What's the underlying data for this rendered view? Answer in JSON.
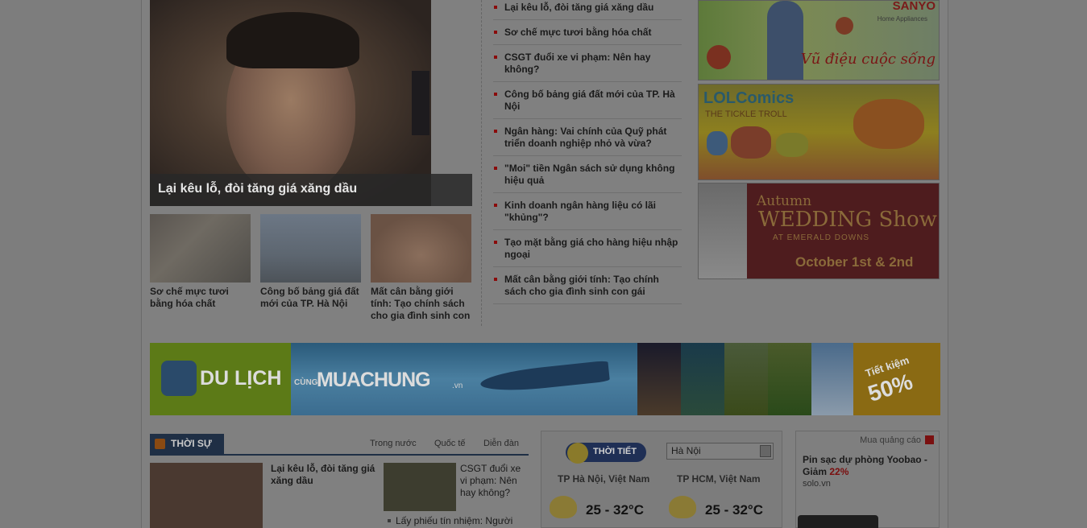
{
  "featured": {
    "caption": "Lại kêu lỗ, đòi tăng giá xăng dầu"
  },
  "thumbs": [
    {
      "caption": "Sơ chế mực tươi bằng hóa chất"
    },
    {
      "caption": "Công bố bảng giá đất mới của TP. Hà Nội"
    },
    {
      "caption": "Mất cân bằng giới tính: Tạo chính sách cho gia đình sinh con"
    }
  ],
  "news": [
    "Lại kêu lỗ, đòi tăng giá xăng dầu",
    "Sơ chế mực tươi bằng hóa chất",
    "CSGT đuổi xe vi phạm: Nên hay không?",
    "Công bố bảng giá đất mới của TP. Hà Nội",
    "Ngân hàng: Vai chính của Quỹ phát triển doanh nghiệp nhỏ và vừa?",
    "\"Moi\" tiền Ngân sách sử dụng không hiệu quả",
    "Kinh doanh ngân hàng liệu có lãi \"khủng\"?",
    "Tạo mặt bằng giá cho hàng hiệu nhập ngoại",
    "Mất cân bằng giới tính: Tạo chính sách cho gia đình sinh con gái"
  ],
  "ads": {
    "sanyo_brand": "SANYO",
    "sanyo_sub": "Home Appliances",
    "sanyo_slogan": "Vũ điệu cuộc sống",
    "lol_title": "LOLComics",
    "lol_sub": "THE TICKLE TROLL",
    "wedding_line1": "Autumn",
    "wedding_line2": "WEDDING Show",
    "wedding_line3": "AT EMERALD DOWNS",
    "wedding_date": "October 1st & 2nd"
  },
  "banner": {
    "brand_left": "DU LỊCH",
    "cung": "CÙNG",
    "brand_right": "MUACHUNG",
    "brand_domain": ".vn",
    "badge_line1": "Tiết kiệm",
    "badge_line2": "50%"
  },
  "section": {
    "title": "THỜI SỰ",
    "links": [
      "Trong nước",
      "Quốc tế",
      "Diễn đàn"
    ]
  },
  "stories": {
    "main_title": "Lại kêu lỗ, đòi tăng giá xăng dầu",
    "second_title": "CSGT đuổi xe vi phạm: Nên hay không?",
    "third_title": "Lấy phiếu tín nhiệm: Người"
  },
  "weather": {
    "label": "THỜI TIẾT",
    "selected_city": "Hà Nội",
    "cities": [
      {
        "name": "TP Hà Nội, Việt Nam",
        "temp": "25 - 32°C"
      },
      {
        "name": "TP HCM, Việt Nam",
        "temp": "25 - 32°C"
      }
    ]
  },
  "ad_small": {
    "label": "Mua quảng cáo",
    "title_prefix": "Pin sạc dự phòng Yoobao - Giảm ",
    "discount": "22%",
    "domain": "solo.vn"
  }
}
